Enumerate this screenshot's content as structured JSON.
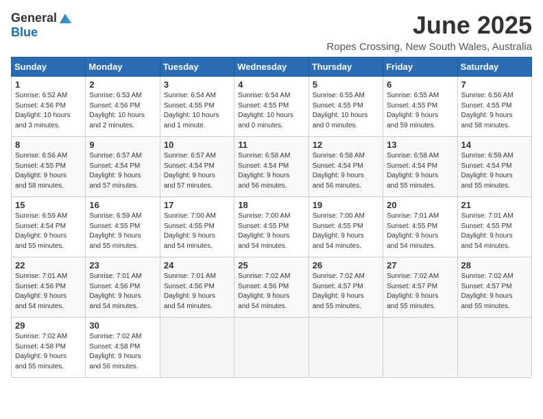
{
  "header": {
    "logo_general": "General",
    "logo_blue": "Blue",
    "month_title": "June 2025",
    "location": "Ropes Crossing, New South Wales, Australia"
  },
  "weekdays": [
    "Sunday",
    "Monday",
    "Tuesday",
    "Wednesday",
    "Thursday",
    "Friday",
    "Saturday"
  ],
  "weeks": [
    [
      {
        "day": "1",
        "info": "Sunrise: 6:52 AM\nSunset: 4:56 PM\nDaylight: 10 hours\nand 3 minutes."
      },
      {
        "day": "2",
        "info": "Sunrise: 6:53 AM\nSunset: 4:56 PM\nDaylight: 10 hours\nand 2 minutes."
      },
      {
        "day": "3",
        "info": "Sunrise: 6:54 AM\nSunset: 4:55 PM\nDaylight: 10 hours\nand 1 minute."
      },
      {
        "day": "4",
        "info": "Sunrise: 6:54 AM\nSunset: 4:55 PM\nDaylight: 10 hours\nand 0 minutes."
      },
      {
        "day": "5",
        "info": "Sunrise: 6:55 AM\nSunset: 4:55 PM\nDaylight: 10 hours\nand 0 minutes."
      },
      {
        "day": "6",
        "info": "Sunrise: 6:55 AM\nSunset: 4:55 PM\nDaylight: 9 hours\nand 59 minutes."
      },
      {
        "day": "7",
        "info": "Sunrise: 6:56 AM\nSunset: 4:55 PM\nDaylight: 9 hours\nand 58 minutes."
      }
    ],
    [
      {
        "day": "8",
        "info": "Sunrise: 6:56 AM\nSunset: 4:55 PM\nDaylight: 9 hours\nand 58 minutes."
      },
      {
        "day": "9",
        "info": "Sunrise: 6:57 AM\nSunset: 4:54 PM\nDaylight: 9 hours\nand 57 minutes."
      },
      {
        "day": "10",
        "info": "Sunrise: 6:57 AM\nSunset: 4:54 PM\nDaylight: 9 hours\nand 57 minutes."
      },
      {
        "day": "11",
        "info": "Sunrise: 6:58 AM\nSunset: 4:54 PM\nDaylight: 9 hours\nand 56 minutes."
      },
      {
        "day": "12",
        "info": "Sunrise: 6:58 AM\nSunset: 4:54 PM\nDaylight: 9 hours\nand 56 minutes."
      },
      {
        "day": "13",
        "info": "Sunrise: 6:58 AM\nSunset: 4:54 PM\nDaylight: 9 hours\nand 55 minutes."
      },
      {
        "day": "14",
        "info": "Sunrise: 6:59 AM\nSunset: 4:54 PM\nDaylight: 9 hours\nand 55 minutes."
      }
    ],
    [
      {
        "day": "15",
        "info": "Sunrise: 6:59 AM\nSunset: 4:54 PM\nDaylight: 9 hours\nand 55 minutes."
      },
      {
        "day": "16",
        "info": "Sunrise: 6:59 AM\nSunset: 4:55 PM\nDaylight: 9 hours\nand 55 minutes."
      },
      {
        "day": "17",
        "info": "Sunrise: 7:00 AM\nSunset: 4:55 PM\nDaylight: 9 hours\nand 54 minutes."
      },
      {
        "day": "18",
        "info": "Sunrise: 7:00 AM\nSunset: 4:55 PM\nDaylight: 9 hours\nand 54 minutes."
      },
      {
        "day": "19",
        "info": "Sunrise: 7:00 AM\nSunset: 4:55 PM\nDaylight: 9 hours\nand 54 minutes."
      },
      {
        "day": "20",
        "info": "Sunrise: 7:01 AM\nSunset: 4:55 PM\nDaylight: 9 hours\nand 54 minutes."
      },
      {
        "day": "21",
        "info": "Sunrise: 7:01 AM\nSunset: 4:55 PM\nDaylight: 9 hours\nand 54 minutes."
      }
    ],
    [
      {
        "day": "22",
        "info": "Sunrise: 7:01 AM\nSunset: 4:56 PM\nDaylight: 9 hours\nand 54 minutes."
      },
      {
        "day": "23",
        "info": "Sunrise: 7:01 AM\nSunset: 4:56 PM\nDaylight: 9 hours\nand 54 minutes."
      },
      {
        "day": "24",
        "info": "Sunrise: 7:01 AM\nSunset: 4:56 PM\nDaylight: 9 hours\nand 54 minutes."
      },
      {
        "day": "25",
        "info": "Sunrise: 7:02 AM\nSunset: 4:56 PM\nDaylight: 9 hours\nand 54 minutes."
      },
      {
        "day": "26",
        "info": "Sunrise: 7:02 AM\nSunset: 4:57 PM\nDaylight: 9 hours\nand 55 minutes."
      },
      {
        "day": "27",
        "info": "Sunrise: 7:02 AM\nSunset: 4:57 PM\nDaylight: 9 hours\nand 55 minutes."
      },
      {
        "day": "28",
        "info": "Sunrise: 7:02 AM\nSunset: 4:57 PM\nDaylight: 9 hours\nand 55 minutes."
      }
    ],
    [
      {
        "day": "29",
        "info": "Sunrise: 7:02 AM\nSunset: 4:58 PM\nDaylight: 9 hours\nand 55 minutes."
      },
      {
        "day": "30",
        "info": "Sunrise: 7:02 AM\nSunset: 4:58 PM\nDaylight: 9 hours\nand 56 minutes."
      },
      {
        "day": "",
        "info": ""
      },
      {
        "day": "",
        "info": ""
      },
      {
        "day": "",
        "info": ""
      },
      {
        "day": "",
        "info": ""
      },
      {
        "day": "",
        "info": ""
      }
    ]
  ]
}
